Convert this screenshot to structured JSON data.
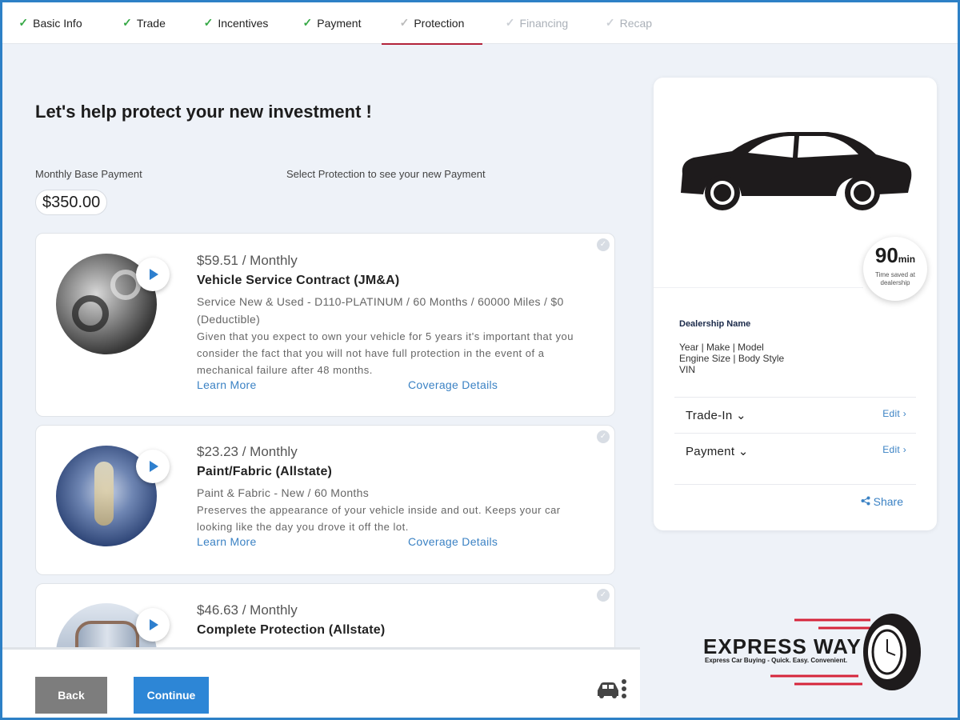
{
  "stepper": {
    "steps": [
      {
        "label": "Basic Info",
        "state": "done"
      },
      {
        "label": "Trade",
        "state": "done"
      },
      {
        "label": "Incentives",
        "state": "done"
      },
      {
        "label": "Payment",
        "state": "done"
      },
      {
        "label": "Protection",
        "state": "active"
      },
      {
        "label": "Financing",
        "state": "todo"
      },
      {
        "label": "Recap",
        "state": "todo"
      }
    ],
    "check_glyph": "✓"
  },
  "main": {
    "heading": "Let's help protect your new investment !",
    "base_payment_label": "Monthly Base Payment",
    "base_payment_value": "$350.00",
    "select_hint": "Select Protection to see your new Payment"
  },
  "products": [
    {
      "price": "$59.51",
      "per": "/ Monthly",
      "title": "Vehicle Service Contract (JM&A)",
      "plan": "Service New & Used - D110-PLATINUM / 60 Months / 60000 Miles / $0 (Deductible)",
      "description": "Given that you expect to own your vehicle for 5 years it's important that you consider the fact that you will not have full protection in the event of a mechanical failure after 48 months.",
      "learn_more": "Learn More",
      "coverage": "Coverage Details",
      "icon": "engine-image"
    },
    {
      "price": "$23.23",
      "per": "/ Monthly",
      "title": "Paint/Fabric (Allstate)",
      "plan": "Paint & Fabric - New / 60 Months",
      "description": "Preserves the appearance of your vehicle inside and out. Keeps your car looking like the day you drove it off the lot.",
      "learn_more": "Learn More",
      "coverage": "Coverage Details",
      "icon": "paint-splash-image"
    },
    {
      "price": "$46.63",
      "per": "/ Monthly",
      "title": "Complete Protection (Allstate)",
      "icon": "shield-image"
    }
  ],
  "footer": {
    "back_label": "Back",
    "continue_label": "Continue"
  },
  "summary": {
    "badge_number": "90",
    "badge_unit": "min",
    "badge_caption": "Time saved at dealership",
    "dealer_name": "Dealership Name",
    "vehicle_line1": "Year | Make | Model",
    "vehicle_line2": "Engine Size | Body Style",
    "vehicle_line3": "VIN",
    "trade_in_label": "Trade-In",
    "payment_label": "Payment",
    "edit_label": "Edit ›",
    "share_label": "Share"
  },
  "logo": {
    "word": "EXPRESS WAY",
    "tagline": "Express Car Buying - Quick. Easy. Convenient."
  },
  "colors": {
    "accent_blue": "#2d86d6",
    "done_green": "#35a845",
    "active_underline": "#b3233a",
    "back_gray": "#7d7d7d"
  }
}
